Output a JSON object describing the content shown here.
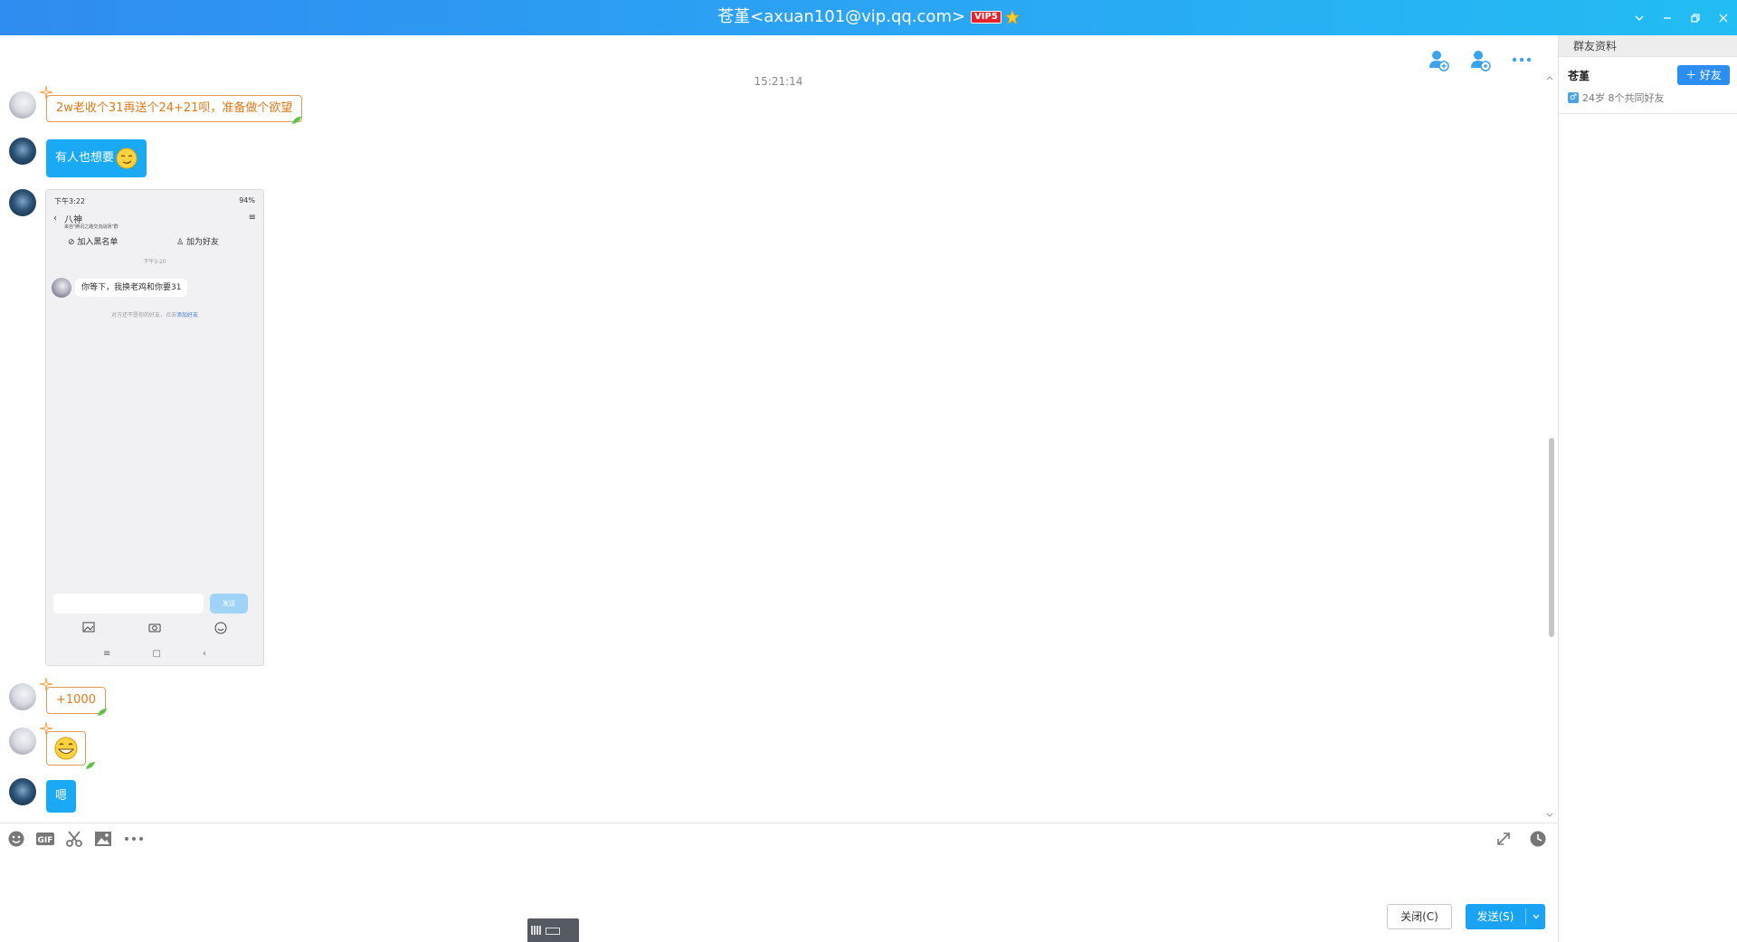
{
  "window": {
    "title": "苍堇<axuan101@vip.qq.com>",
    "vip_badge": "VIP5"
  },
  "chat": {
    "timestamp": "15:21:14",
    "messages": [
      {
        "sender": "contact",
        "type": "text",
        "text": "2w老收个31再送个24+21呗，准备做个欲望"
      },
      {
        "sender": "me",
        "type": "text",
        "text": "有人也想要",
        "emoji": "sly-smile-emoji"
      },
      {
        "sender": "me",
        "type": "image",
        "description": "phone-screenshot"
      },
      {
        "sender": "contact",
        "type": "text",
        "text": "+1000"
      },
      {
        "sender": "contact",
        "type": "emoji",
        "emoji": "grin-emoji"
      },
      {
        "sender": "me",
        "type": "text",
        "text": "嗯"
      }
    ],
    "phone": {
      "status_time": "下午3:22",
      "battery": "94%",
      "contact_name": "八神",
      "contact_sub": "来自\"腾讯之路交流战场\"群",
      "blacklist": "加入黑名单",
      "add_friend": "加为好友",
      "time": "下午3:20",
      "message": "你等下，我换老鸡和你要31",
      "notice": "对方还不是你的好友，点击",
      "notice_link": "添加好友",
      "send": "发送"
    }
  },
  "toolbar": {
    "close_label": "关闭(C)",
    "send_label": "发送(S)"
  },
  "panel": {
    "title": "群友资料",
    "name": "苍堇",
    "add_label": "好友",
    "info": "24岁 8个共同好友"
  },
  "colors": {
    "titlebar": "#2aa9f4",
    "my_bubble": "#1aa9f5",
    "contact_text": "#e07a18",
    "send_button": "#1aa3f3"
  }
}
